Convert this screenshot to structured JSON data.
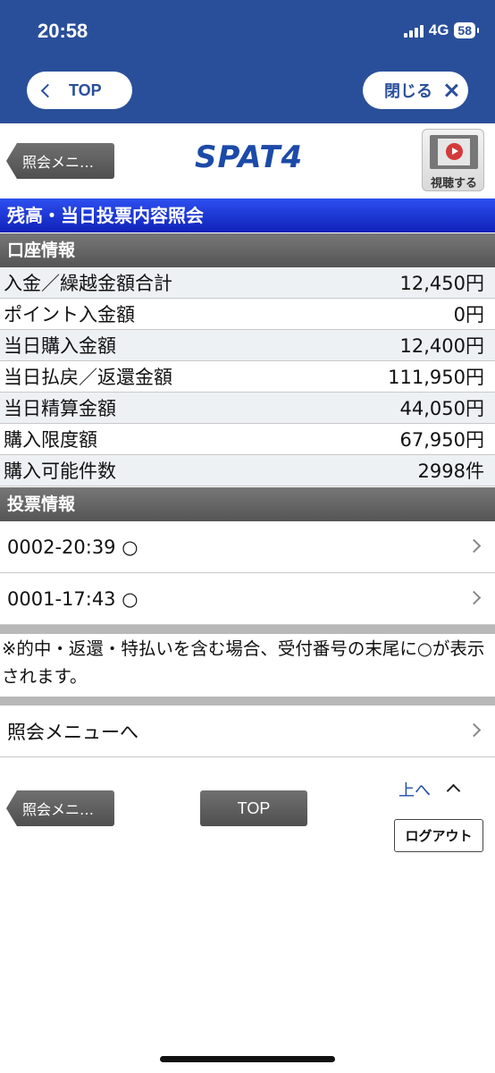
{
  "status_bar": {
    "time": "20:58",
    "network": "4G",
    "battery": "58"
  },
  "browser_nav": {
    "top_label": "TOP",
    "close_label": "閉じる"
  },
  "header": {
    "menu_button": "照会メニ…",
    "logo": "SPAT4",
    "video_label": "視聴する"
  },
  "page_title": "残高・当日投票内容照会",
  "account": {
    "heading": "口座情報",
    "rows": [
      {
        "label": "入金／繰越金額合計",
        "value": "12,450円"
      },
      {
        "label": "ポイント入金額",
        "value": "0円"
      },
      {
        "label": "当日購入金額",
        "value": "12,400円"
      },
      {
        "label": "当日払戻／返還金額",
        "value": "111,950円"
      },
      {
        "label": "当日精算金額",
        "value": "44,050円"
      },
      {
        "label": "購入限度額",
        "value": "67,950円"
      },
      {
        "label": "購入可能件数",
        "value": "2998件"
      }
    ]
  },
  "votes": {
    "heading": "投票情報",
    "items": [
      {
        "label": "0002-20:39 ○"
      },
      {
        "label": "0001-17:43 ○"
      }
    ]
  },
  "note": "※的中・返還・特払いを含む場合、受付番号の末尾に○が表示されます。",
  "menu_link": "照会メニューへ",
  "footer": {
    "menu_button": "照会メニ…",
    "top_button": "TOP",
    "up_link": "上へ",
    "logout": "ログアウト"
  },
  "colors": {
    "brand_blue": "#2a4f9a",
    "title_bar": "#1a35d8",
    "section_gray": "#666666"
  }
}
